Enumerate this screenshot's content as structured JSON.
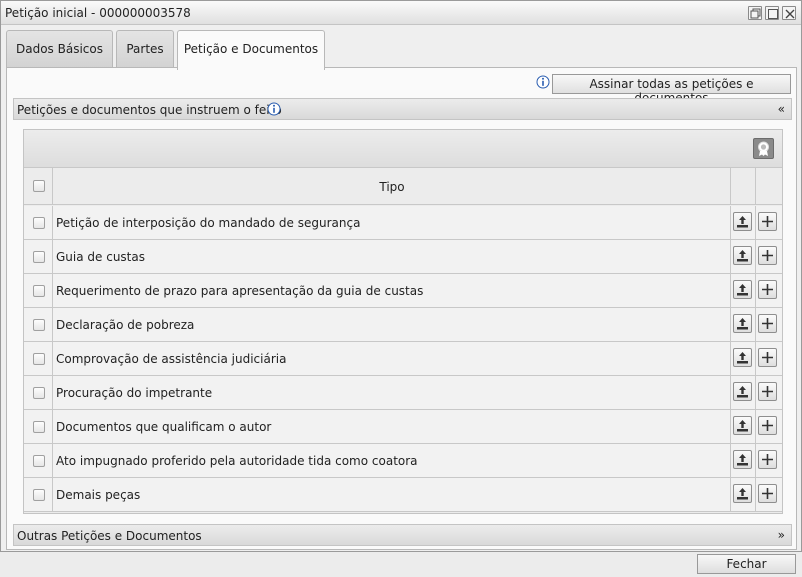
{
  "window": {
    "title": "Petição inicial - 000000003578"
  },
  "tabs": [
    {
      "label": "Dados Básicos"
    },
    {
      "label": "Partes"
    },
    {
      "label": "Petição e Documentos"
    }
  ],
  "toolbar": {
    "sign_all_label": "Assinar todas as petições e documentos"
  },
  "section_docs": {
    "title": "Petições e documentos que instruem o feito",
    "chevron": "«"
  },
  "grid": {
    "column_header": "Tipo",
    "rows": [
      {
        "tipo": "Petição de interposição do mandado de segurança"
      },
      {
        "tipo": "Guia de custas"
      },
      {
        "tipo": "Requerimento de prazo para apresentação da guia de custas"
      },
      {
        "tipo": "Declaração de pobreza"
      },
      {
        "tipo": "Comprovação de assistência judiciária"
      },
      {
        "tipo": "Procuração do impetrante"
      },
      {
        "tipo": "Documentos que qualificam o autor"
      },
      {
        "tipo": "Ato impugnado proferido pela autoridade tida como coatora"
      },
      {
        "tipo": "Demais peças"
      }
    ]
  },
  "section_other": {
    "title": "Outras Petições e Documentos",
    "chevron": "»"
  },
  "footer": {
    "close_label": "Fechar"
  },
  "icons": {
    "info": "info-icon",
    "seal": "certificate-seal-icon",
    "upload": "upload-icon",
    "add": "plus-icon"
  },
  "colors": {
    "info_blue": "#2a5db0"
  }
}
